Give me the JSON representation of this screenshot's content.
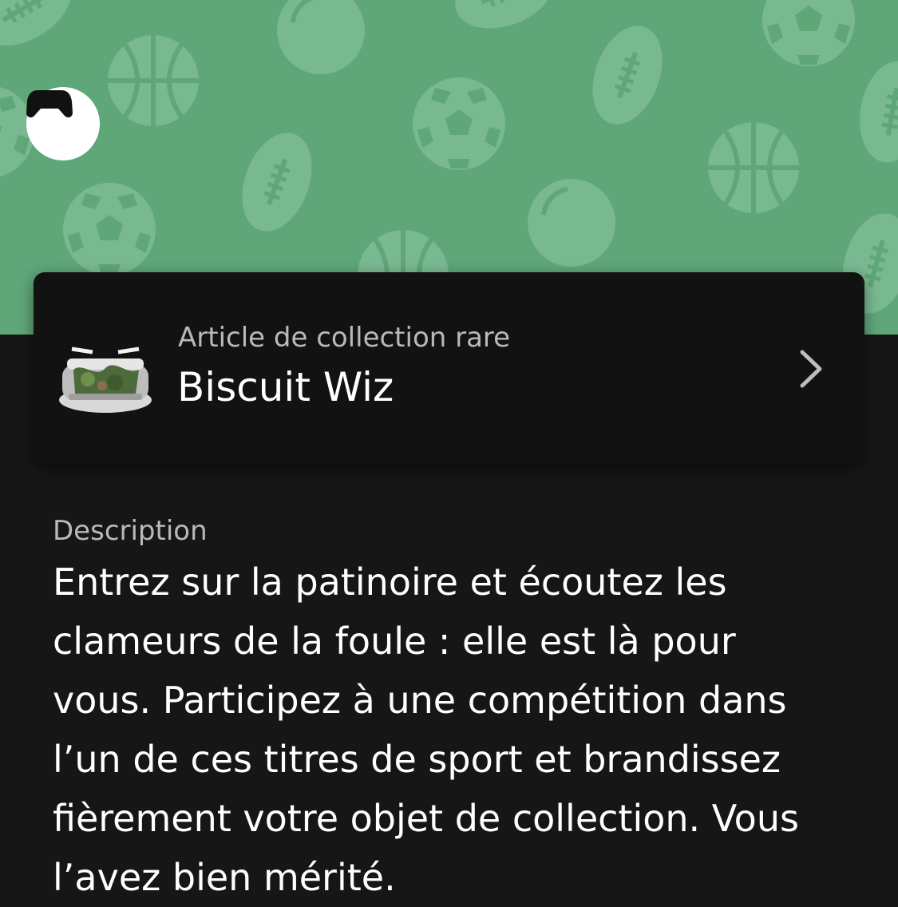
{
  "header": {
    "background_color": "#5fa679",
    "pattern_icons": [
      "soccer-ball-icon",
      "basketball-icon",
      "football-icon",
      "bowling-ball-icon"
    ],
    "badge_icon": "gamepad-icon"
  },
  "collectible": {
    "eyebrow": "Article de collection rare",
    "name": "Biscuit Wiz",
    "thumbnail_icon": "hockey-rink-trophy-icon",
    "chevron_icon": "chevron-right-icon"
  },
  "description": {
    "label": "Description",
    "text": "Entrez sur la patinoire et écoutez les clameurs de la foule : elle est là pour vous. Participez à une compétition dans l’un de ces titres de sport et brandissez fièrement votre objet de collection. Vous l’avez bien mérité."
  }
}
